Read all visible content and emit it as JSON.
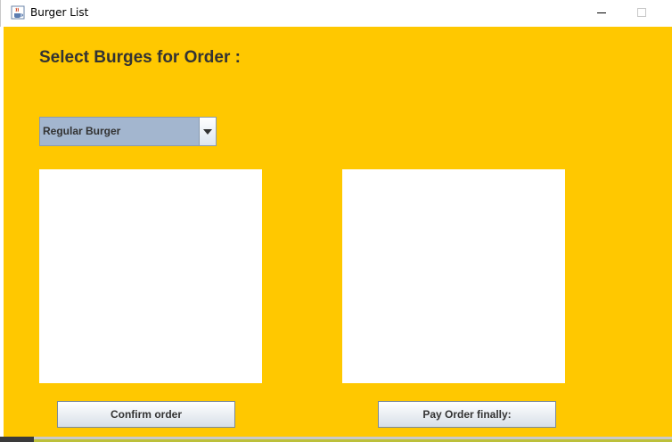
{
  "window": {
    "title": "Burger List",
    "icon": "java-cup-icon"
  },
  "heading": "Select Burges for Order :",
  "burger_select": {
    "selected": "Regular Burger"
  },
  "buttons": {
    "confirm_label": "Confirm order",
    "pay_label": "Pay Order finally:"
  },
  "colors": {
    "background": "#ffc800",
    "combo": "#a3b6cf",
    "panels": "#ffffff"
  }
}
